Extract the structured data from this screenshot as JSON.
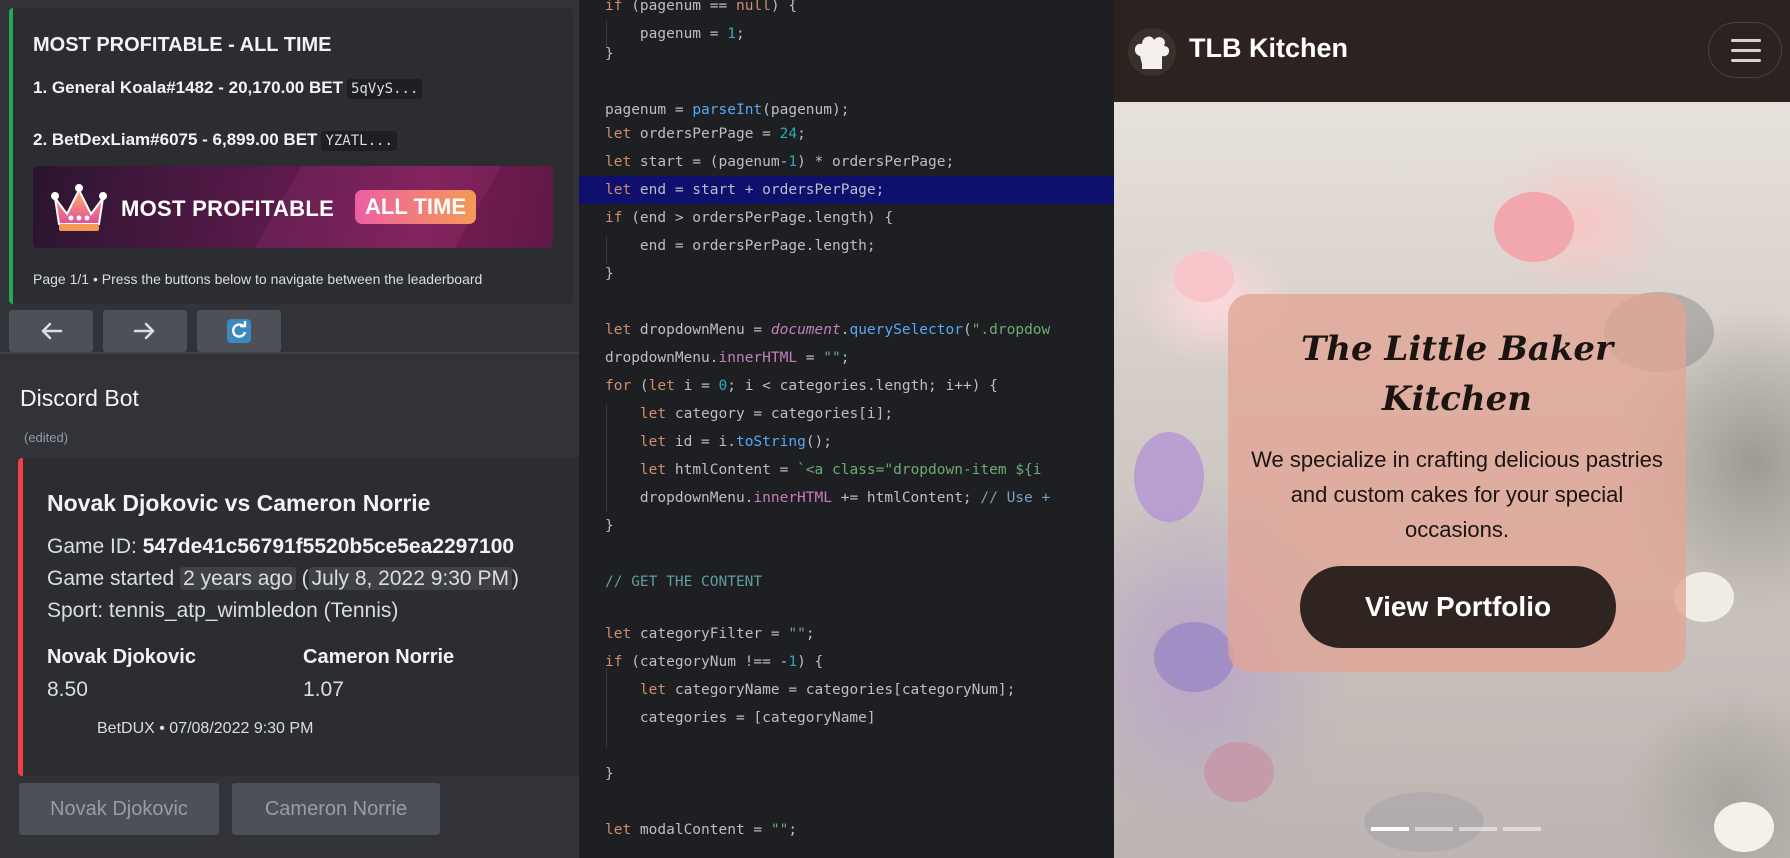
{
  "discord": {
    "leaderboard": {
      "title": "MOST PROFITABLE - ALL TIME",
      "entries": [
        {
          "rank_text": "1. General Koala#1482 - 20,170.00 BET",
          "wallet": "5qVyS..."
        },
        {
          "rank_text": "2. BetDexLiam#6075 - 6,899.00 BET",
          "wallet": "YZATL..."
        }
      ],
      "banner_text": "MOST PROFITABLE",
      "banner_pill": "ALL TIME",
      "footer": "Page 1/1 • Press the buttons below to navigate between the leaderboard",
      "accent": "#23a55a"
    },
    "nav_buttons": [
      "arrow-left-icon",
      "arrow-right-icon",
      "refresh-icon"
    ],
    "bot_name": "Discord Bot",
    "edited": "(edited)",
    "match": {
      "title": "Novak Djokovic vs Cameron Norrie",
      "game_id_label": "Game ID:",
      "game_id": "547de41c56791f5520b5ce5ea2297100",
      "started_label": "Game started",
      "started_relative": "2 years ago",
      "started_absolute": "July 8, 2022 9:30 PM",
      "sport": "Sport: tennis_atp_wimbledon (Tennis)",
      "home_name": "Novak Djokovic",
      "home_odds": "8.50",
      "away_name": "Cameron Norrie",
      "away_odds": "1.07",
      "footer": "BetDUX • 07/08/2022 9:30 PM",
      "accent": "#f23f43"
    },
    "bet_buttons": [
      "Novak Djokovic",
      "Cameron Norrie"
    ]
  },
  "editor": {
    "lines": [
      "if (pagenum == null) {",
      "    pagenum = 1;",
      "}",
      "",
      "pagenum = parseInt(pagenum);",
      "let ordersPerPage = 24;",
      "let start = (pagenum-1) * ordersPerPage;",
      "let end = start + ordersPerPage;",
      "if (end > ordersPerPage.length) {",
      "    end = ordersPerPage.length;",
      "}",
      "",
      "let dropdownMenu = document.querySelector(\".dropdow",
      "dropdownMenu.innerHTML = \"\";",
      "for (let i = 0; i < categories.length; i++) {",
      "    let category = categories[i];",
      "    let id = i.toString();",
      "    let htmlContent = `<a class=\"dropdown-item ${i",
      "    dropdownMenu.innerHTML += htmlContent; // Use +",
      "}",
      "",
      "// GET THE CONTENT",
      "",
      "let categoryFilter = \"\";",
      "if (categoryNum !== -1) {",
      "    let categoryName = categories[categoryNum];",
      "    categories = [categoryName]",
      "",
      "}",
      "",
      "let modalContent = \"\";"
    ],
    "highlighted_line": 8,
    "highlight_color": "#0f0f6e"
  },
  "website": {
    "brand": "TLB Kitchen",
    "hero_title_line1": "The Little Baker",
    "hero_title_line2": "Kitchen",
    "hero_text": "We specialize in crafting delicious pastries and custom cakes for your special occasions.",
    "cta": "View Portfolio",
    "carousel_slides": 4,
    "active_slide": 1,
    "colors": {
      "nav": "#2c2320",
      "card": "#e2a596",
      "cta": "#2f2420"
    }
  }
}
